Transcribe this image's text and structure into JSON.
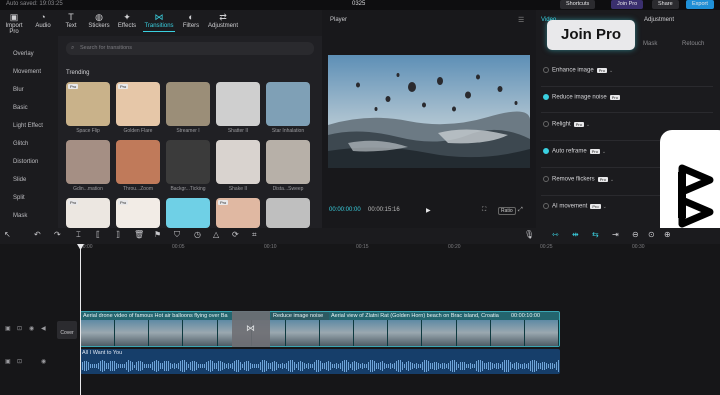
{
  "window": {
    "autosave": "Auto saved: 19:03:25",
    "title": "0325",
    "shortcuts": "Shortcuts",
    "join_pro": "Join Pro",
    "share": "Share",
    "export": "Export"
  },
  "toptabs": [
    {
      "label": "Import",
      "sub": "Pro",
      "icon": "▣"
    },
    {
      "label": "Audio",
      "icon": "◔"
    },
    {
      "label": "Text",
      "icon": "T"
    },
    {
      "label": "Stickers",
      "icon": "◍"
    },
    {
      "label": "Effects",
      "icon": "✦"
    },
    {
      "label": "Transitions",
      "icon": "⋈"
    },
    {
      "label": "Filters",
      "icon": "◐"
    },
    {
      "label": "Adjustment",
      "icon": "⇄"
    }
  ],
  "sidebar": {
    "items": [
      "Overlay",
      "Movement",
      "Blur",
      "Basic",
      "Light Effect",
      "Glitch",
      "Distortion",
      "Slide",
      "Split",
      "Mask"
    ]
  },
  "browser": {
    "search_placeholder": "Search for transitions",
    "section": "Trending",
    "thumbs": [
      {
        "label": "Space Flip",
        "pro": "Pro",
        "color": "#c9b28a"
      },
      {
        "label": "Golden Flare",
        "pro": "Pro",
        "color": "#e6c7a8"
      },
      {
        "label": "Streamer I",
        "pro": "",
        "color": "#9b8e78"
      },
      {
        "label": "Shatter II",
        "pro": "",
        "color": "#cfcfcf"
      },
      {
        "label": "Star Inhalation",
        "pro": "",
        "color": "#7fa0b6"
      },
      {
        "label": "Gdin...mation",
        "pro": "",
        "color": "#a58f84"
      },
      {
        "label": "Throu...Zoom",
        "pro": "",
        "color": "#c07a5a"
      },
      {
        "label": "Backgr...Ticking",
        "pro": "",
        "color": "#3b3b3b"
      },
      {
        "label": "Shake II",
        "pro": "",
        "color": "#d9d3cf"
      },
      {
        "label": "Dista...Sweep",
        "pro": "",
        "color": "#b7b0a8"
      },
      {
        "label": "",
        "pro": "Pro",
        "color": "#ece7e1"
      },
      {
        "label": "",
        "pro": "Pro",
        "color": "#f2ece6"
      },
      {
        "label": "",
        "pro": "",
        "color": "#6fd0e6"
      },
      {
        "label": "",
        "pro": "Pro",
        "color": "#e0b8a2"
      },
      {
        "label": "",
        "pro": "",
        "color": "#bfbfbf"
      }
    ]
  },
  "player": {
    "label": "Player",
    "time_current": "00:00:00:00",
    "time_total": "00:00:15:16",
    "ratio": "Ratio"
  },
  "right_panel": {
    "tab_video": "Video",
    "tab_adjustment": "Adjustment",
    "sub_mask": "Mask",
    "sub_retouch": "Retouch",
    "join_pro_badge": "Join Pro",
    "options": [
      {
        "label": "Enhance image",
        "on": false,
        "pro": "Pro"
      },
      {
        "label": "Reduce image noise",
        "on": true,
        "pro": "Pro"
      },
      {
        "label": "Relight",
        "on": false,
        "pro": "Pro"
      },
      {
        "label": "Auto reframe",
        "on": true,
        "pro": "Pro"
      },
      {
        "label": "Remove flickers",
        "on": false,
        "pro": "Pro"
      },
      {
        "label": "AI movement",
        "on": false,
        "pro": "Pro"
      }
    ]
  },
  "timeline": {
    "ruler": [
      "00:00",
      "00:05",
      "00:10",
      "00:15",
      "00:20",
      "00:25",
      "00:30"
    ],
    "video_clip_1": "Aerial drone video of famous Hot air balloons flying over Ba",
    "video_clip_2": "Reduce image noise",
    "video_clip_3": "Aerial view of Zlatni Rat (Golden Horn) beach on Brac island, Croatia",
    "video_clip_3_duration": "00:00:10:00",
    "audio_clip": "All I Want to You",
    "cover_label": "Cover"
  }
}
